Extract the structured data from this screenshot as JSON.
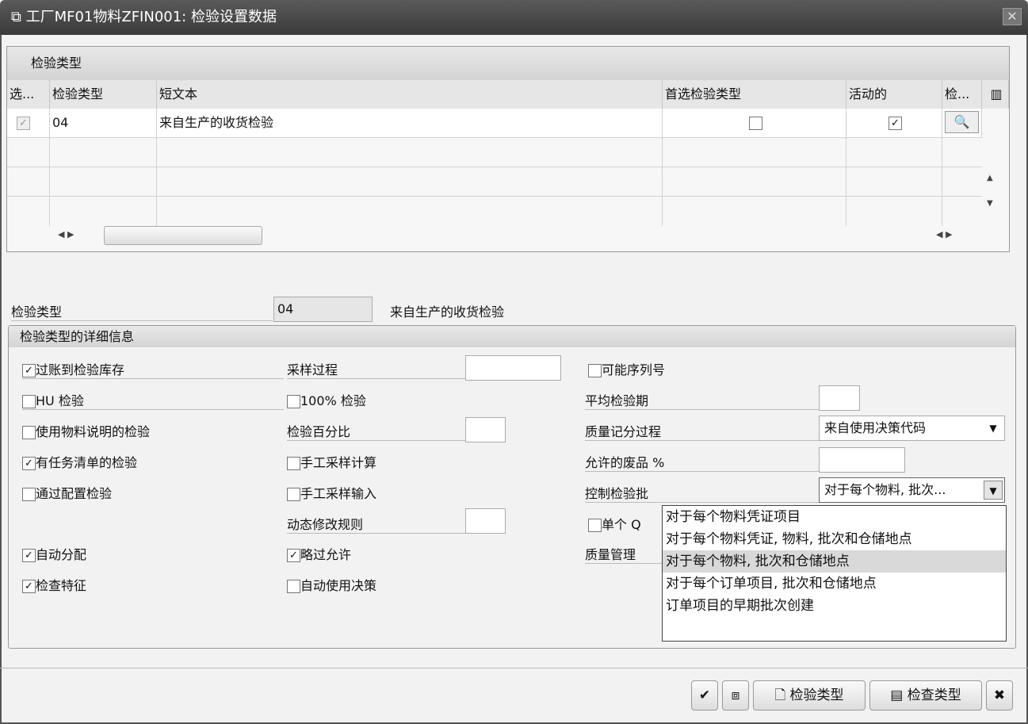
{
  "window": {
    "title": "工厂MF01物料ZFIN001: 检验设置数据",
    "close": "✕"
  },
  "table": {
    "group_title": "检验类型",
    "columns": [
      "选...",
      "检验类型",
      "短文本",
      "首选检验类型",
      "活动的",
      "检..."
    ],
    "rows": [
      {
        "selected": true,
        "type": "04",
        "text": "来自生产的收货检验",
        "preferred": false,
        "active": true
      }
    ]
  },
  "header": {
    "label": "检验类型",
    "code": "04",
    "desc": "来自生产的收货检验"
  },
  "details": {
    "title": "检验类型的详细信息",
    "col1": [
      {
        "label": "过账到检验库存",
        "checked": true
      },
      {
        "label": "HU 检验",
        "checked": false
      },
      {
        "label": "使用物料说明的检验",
        "checked": false
      },
      {
        "label": "有任务清单的检验",
        "checked": true
      },
      {
        "label": "通过配置检验",
        "checked": false
      },
      {
        "label": "自动分配",
        "checked": true
      },
      {
        "label": "检查特征",
        "checked": true
      }
    ],
    "col2": {
      "sampling_proc": "采样过程",
      "hundred": "100% 检验",
      "percent": "检验百分比",
      "manual_calc": "手工采样计算",
      "manual_input": "手工采样输入",
      "dyn_rule": "动态修改规则",
      "skip": "略过允许",
      "auto_ud": "自动使用决策"
    },
    "col3": {
      "serial": "可能序列号",
      "avg_dur": "平均检验期",
      "qscore": "质量记分过程",
      "qscore_value": "来自使用决策代码",
      "scrap": "允许的废品 %",
      "control": "控制检验批",
      "control_value": "对于每个物料, 批次...",
      "single_q": "单个 Q",
      "qm": "质量管理"
    }
  },
  "dropdown": {
    "options": [
      "对于每个物料凭证项目",
      "对于每个物料凭证, 物料, 批次和仓储地点",
      "对于每个物料, 批次和仓储地点",
      "对于每个订单项目, 批次和仓储地点",
      "订单项目的早期批次创建"
    ],
    "highlighted": 2
  },
  "footer": {
    "insp_type": "检验类型",
    "check_type": "检查类型"
  }
}
